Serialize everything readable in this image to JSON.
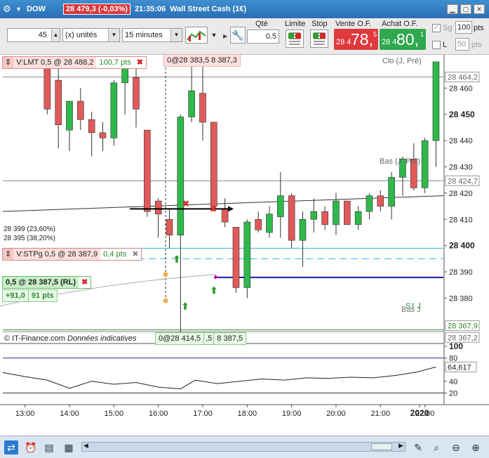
{
  "window": {
    "symbol": "DOW",
    "price_change": "28 479,3 (-0,03%)",
    "time": "21:35:06",
    "instrument": "Wall Street Cash (1€)"
  },
  "toolbar": {
    "quantity_value": "45",
    "unit_select": "(x) unités",
    "interval_select": "15 minutes",
    "qty_label": "Qté",
    "qty_value": "0.5",
    "limit_label": "Limite",
    "stop_label": "Stop",
    "sell_label": "Vente O.F.",
    "buy_label": "Achat O.F.",
    "sell_prefix": "28 4",
    "sell_big": "78,",
    "sell_sup": "5",
    "buy_prefix": "28 4",
    "buy_big": "80,",
    "buy_sup": "1",
    "sg_label": "Sg",
    "sg_value": "100",
    "sg_unit": "pts",
    "l_label": "L",
    "l_value": "50",
    "l_unit": "pts"
  },
  "chart": {
    "price_axis": [
      "28 460",
      "28 450",
      "28 440",
      "28 430",
      "28 420",
      "28 410",
      "28 400",
      "28 390",
      "28 380"
    ],
    "price_badges": [
      "28 464,2",
      "28 424,7",
      "28 367,9",
      "28 367,2"
    ],
    "osc_axis": [
      "100",
      "80",
      "60",
      "40",
      "20"
    ],
    "osc_badge": "64,617",
    "time_axis": [
      "13:00",
      "14:00",
      "15:00",
      "16:00",
      "17:00",
      "18:00",
      "19:00",
      "20:00",
      "21:00",
      "22:00",
      "2020"
    ],
    "line_labels": {
      "close": "Clo (J, Pré)",
      "low": "Bas (J, Pré)",
      "s1": "S1 J",
      "low2": "Bas J"
    },
    "fib_labels": [
      "28 399 (23,60%)",
      "28 395 (38,20%)"
    ],
    "credit_source": "© IT-Finance.com",
    "credit_note": "Données indicatives"
  },
  "orders": {
    "limit_tag": "V:LMT  0,5 @ 28 488,2",
    "limit_pts": "100,7 pts",
    "top_tag": "0@28 383,5  8 387,3",
    "stop_tag": "V:STPg  0,5 @ 28 387,9",
    "stop_pts": "0,4 pts",
    "position_tag": "0,5 @ 28 387,5 (RL)",
    "pl_value": "+91,0",
    "pl_pts": "91 pts",
    "bottom_tag_a": "0@28 414,5",
    "bottom_tag_b": ",5",
    "bottom_tag_c": "8 387,5"
  },
  "chart_data": {
    "type": "candlestick",
    "ylim": [
      28367,
      28470
    ],
    "xlim_minutes": [
      750,
      1345
    ],
    "candles": [
      {
        "t": 810,
        "o": 28470,
        "h": 28470,
        "l": 28450,
        "c": 28452
      },
      {
        "t": 825,
        "o": 28463,
        "h": 28470,
        "l": 28437,
        "c": 28446
      },
      {
        "t": 840,
        "o": 28444,
        "h": 28452,
        "l": 28436,
        "c": 28455
      },
      {
        "t": 855,
        "o": 28455,
        "h": 28460,
        "l": 28444,
        "c": 28448
      },
      {
        "t": 870,
        "o": 28448,
        "h": 28451,
        "l": 28434,
        "c": 28443
      },
      {
        "t": 885,
        "o": 28443,
        "h": 28447,
        "l": 28436,
        "c": 28441
      },
      {
        "t": 900,
        "o": 28441,
        "h": 28463,
        "l": 28438,
        "c": 28462
      },
      {
        "t": 915,
        "o": 28462,
        "h": 28470,
        "l": 28450,
        "c": 28468
      },
      {
        "t": 930,
        "o": 28464,
        "h": 28468,
        "l": 28445,
        "c": 28452
      },
      {
        "t": 945,
        "o": 28444,
        "h": 28444,
        "l": 28411,
        "c": 28413
      },
      {
        "t": 960,
        "o": 28417,
        "h": 28418,
        "l": 28403,
        "c": 28412
      },
      {
        "t": 975,
        "o": 28410,
        "h": 28414,
        "l": 28399,
        "c": 28404
      },
      {
        "t": 990,
        "o": 28404,
        "h": 28450,
        "l": 28367,
        "c": 28449
      },
      {
        "t": 1005,
        "o": 28449,
        "h": 28470,
        "l": 28447,
        "c": 28459
      },
      {
        "t": 1020,
        "o": 28458,
        "h": 28470,
        "l": 28440,
        "c": 28447
      },
      {
        "t": 1035,
        "o": 28447,
        "h": 28447,
        "l": 28413,
        "c": 28415
      },
      {
        "t": 1050,
        "o": 28414,
        "h": 28418,
        "l": 28407,
        "c": 28409
      },
      {
        "t": 1065,
        "o": 28407,
        "h": 28407,
        "l": 28382,
        "c": 28384
      },
      {
        "t": 1080,
        "o": 28384,
        "h": 28410,
        "l": 28380,
        "c": 28409
      },
      {
        "t": 1095,
        "o": 28410,
        "h": 28413,
        "l": 28405,
        "c": 28406
      },
      {
        "t": 1110,
        "o": 28405,
        "h": 28415,
        "l": 28403,
        "c": 28412
      },
      {
        "t": 1125,
        "o": 28411,
        "h": 28428,
        "l": 28403,
        "c": 28419
      },
      {
        "t": 1140,
        "o": 28419,
        "h": 28420,
        "l": 28399,
        "c": 28402
      },
      {
        "t": 1155,
        "o": 28402,
        "h": 28413,
        "l": 28392,
        "c": 28410
      },
      {
        "t": 1170,
        "o": 28410,
        "h": 28418,
        "l": 28405,
        "c": 28413
      },
      {
        "t": 1185,
        "o": 28413,
        "h": 28415,
        "l": 28406,
        "c": 28408
      },
      {
        "t": 1200,
        "o": 28408,
        "h": 28420,
        "l": 28404,
        "c": 28417
      },
      {
        "t": 1215,
        "o": 28417,
        "h": 28417,
        "l": 28408,
        "c": 28408
      },
      {
        "t": 1230,
        "o": 28408,
        "h": 28415,
        "l": 28406,
        "c": 28413
      },
      {
        "t": 1245,
        "o": 28413,
        "h": 28420,
        "l": 28410,
        "c": 28419
      },
      {
        "t": 1260,
        "o": 28419,
        "h": 28421,
        "l": 28413,
        "c": 28415
      },
      {
        "t": 1275,
        "o": 28415,
        "h": 28428,
        "l": 28410,
        "c": 28426
      },
      {
        "t": 1290,
        "o": 28426,
        "h": 28434,
        "l": 28419,
        "c": 28433
      },
      {
        "t": 1305,
        "o": 28433,
        "h": 28439,
        "l": 28421,
        "c": 28422
      },
      {
        "t": 1320,
        "o": 28422,
        "h": 28441,
        "l": 28420,
        "c": 28440
      },
      {
        "t": 1335,
        "o": 28440,
        "h": 28470,
        "l": 28430,
        "c": 28470
      }
    ],
    "horizontal_lines": [
      {
        "price": 28464.2,
        "color": "#888888"
      },
      {
        "price": 28424.7,
        "color": "#888888"
      },
      {
        "price": 28399,
        "color": "#33b5e5"
      },
      {
        "price": 28395,
        "color": "#33b5e5"
      },
      {
        "price": 28387.9,
        "color": "#1a1aa0"
      },
      {
        "price": 28367.9,
        "color": "#2e8b2e"
      },
      {
        "price": 28367.2,
        "color": "#888888"
      }
    ],
    "oscillator": {
      "ylim": [
        0,
        100
      ],
      "levels": [
        80,
        20
      ],
      "values": [
        {
          "t": 750,
          "v": 55
        },
        {
          "t": 780,
          "v": 48
        },
        {
          "t": 810,
          "v": 42
        },
        {
          "t": 840,
          "v": 28
        },
        {
          "t": 870,
          "v": 40
        },
        {
          "t": 900,
          "v": 35
        },
        {
          "t": 930,
          "v": 38
        },
        {
          "t": 960,
          "v": 30
        },
        {
          "t": 990,
          "v": 27
        },
        {
          "t": 1010,
          "v": 42
        },
        {
          "t": 1040,
          "v": 36
        },
        {
          "t": 1070,
          "v": 40
        },
        {
          "t": 1100,
          "v": 44
        },
        {
          "t": 1130,
          "v": 42
        },
        {
          "t": 1160,
          "v": 46
        },
        {
          "t": 1190,
          "v": 45
        },
        {
          "t": 1220,
          "v": 47
        },
        {
          "t": 1250,
          "v": 46
        },
        {
          "t": 1280,
          "v": 50
        },
        {
          "t": 1310,
          "v": 56
        },
        {
          "t": 1335,
          "v": 64.6
        }
      ]
    }
  },
  "colors": {
    "up": "#2fb84c",
    "down": "#e05a5a",
    "sell": "#e0393e",
    "buy": "#2fa84f"
  }
}
